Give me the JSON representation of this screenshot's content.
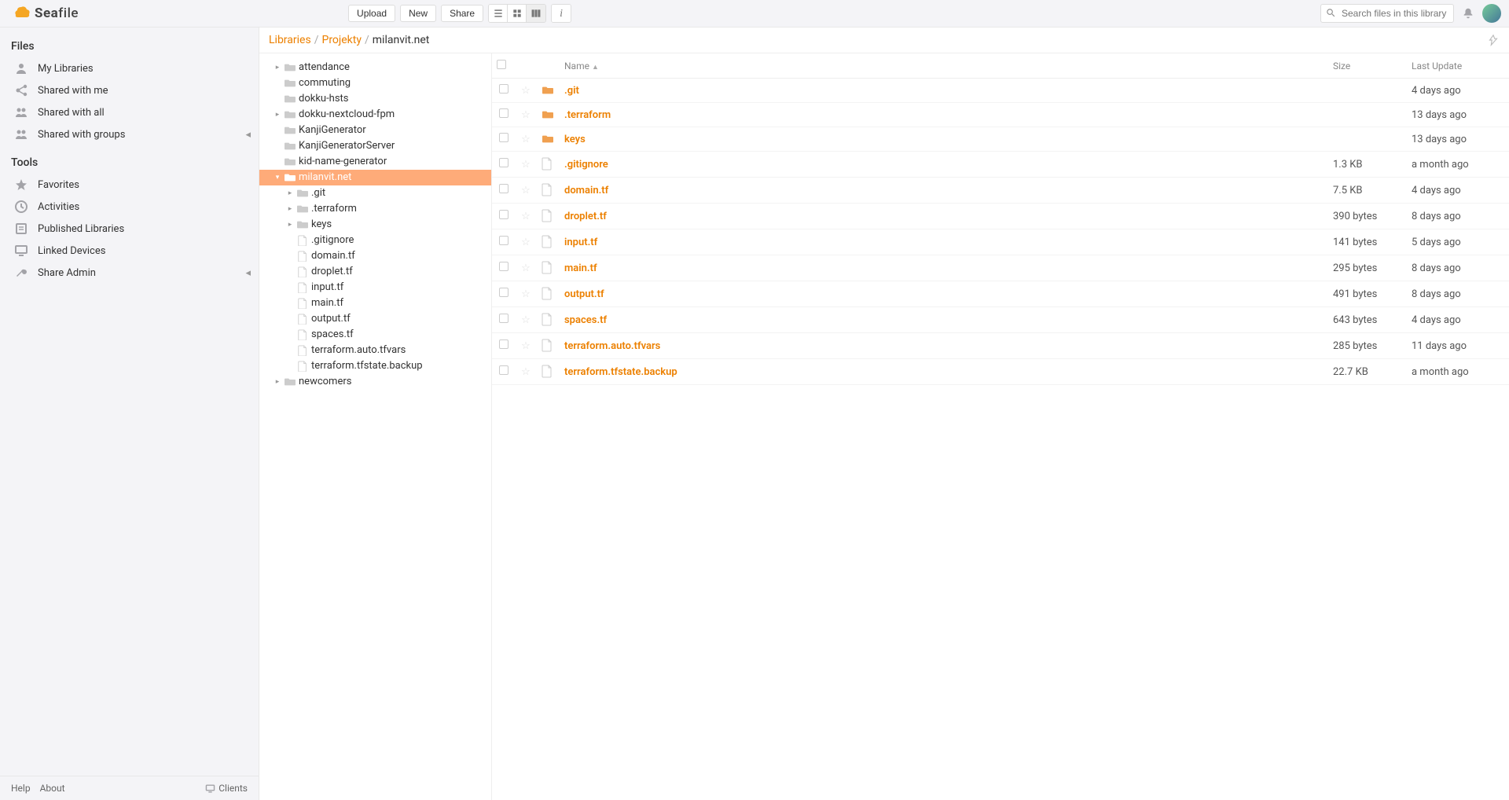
{
  "brand": {
    "bold": "Sea",
    "rest": "file"
  },
  "topbar": {
    "upload": "Upload",
    "new": "New",
    "share": "Share",
    "search_placeholder": "Search files in this library"
  },
  "sidebar": {
    "sections": {
      "files": {
        "title": "Files",
        "items": [
          {
            "label": "My Libraries",
            "icon": "user"
          },
          {
            "label": "Shared with me",
            "icon": "share-in"
          },
          {
            "label": "Shared with all",
            "icon": "share-all"
          },
          {
            "label": "Shared with groups",
            "icon": "group",
            "caret": true
          }
        ]
      },
      "tools": {
        "title": "Tools",
        "items": [
          {
            "label": "Favorites",
            "icon": "star"
          },
          {
            "label": "Activities",
            "icon": "clock"
          },
          {
            "label": "Published Libraries",
            "icon": "book"
          },
          {
            "label": "Linked Devices",
            "icon": "monitor"
          },
          {
            "label": "Share Admin",
            "icon": "wrench",
            "caret": true
          }
        ]
      }
    },
    "footer": {
      "help": "Help",
      "about": "About",
      "clients": "Clients"
    }
  },
  "breadcrumb": {
    "parts": [
      {
        "label": "Libraries",
        "link": true
      },
      {
        "label": "Projekty",
        "link": true
      },
      {
        "label": "milanvit.net",
        "link": false
      }
    ]
  },
  "tree": [
    {
      "name": "attendance",
      "type": "folder",
      "depth": 0,
      "expander": "▸"
    },
    {
      "name": "commuting",
      "type": "folder",
      "depth": 0,
      "expander": ""
    },
    {
      "name": "dokku-hsts",
      "type": "folder",
      "depth": 0,
      "expander": ""
    },
    {
      "name": "dokku-nextcloud-fpm",
      "type": "folder",
      "depth": 0,
      "expander": "▸"
    },
    {
      "name": "KanjiGenerator",
      "type": "folder",
      "depth": 0,
      "expander": ""
    },
    {
      "name": "KanjiGeneratorServer",
      "type": "folder",
      "depth": 0,
      "expander": ""
    },
    {
      "name": "kid-name-generator",
      "type": "folder",
      "depth": 0,
      "expander": ""
    },
    {
      "name": "milanvit.net",
      "type": "folder",
      "depth": 0,
      "expander": "▾",
      "selected": true
    },
    {
      "name": ".git",
      "type": "folder",
      "depth": 1,
      "expander": "▸"
    },
    {
      "name": ".terraform",
      "type": "folder",
      "depth": 1,
      "expander": "▸"
    },
    {
      "name": "keys",
      "type": "folder",
      "depth": 1,
      "expander": "▸"
    },
    {
      "name": ".gitignore",
      "type": "file",
      "depth": 1,
      "expander": ""
    },
    {
      "name": "domain.tf",
      "type": "file",
      "depth": 1,
      "expander": ""
    },
    {
      "name": "droplet.tf",
      "type": "file",
      "depth": 1,
      "expander": ""
    },
    {
      "name": "input.tf",
      "type": "file",
      "depth": 1,
      "expander": ""
    },
    {
      "name": "main.tf",
      "type": "file",
      "depth": 1,
      "expander": ""
    },
    {
      "name": "output.tf",
      "type": "file",
      "depth": 1,
      "expander": ""
    },
    {
      "name": "spaces.tf",
      "type": "file",
      "depth": 1,
      "expander": ""
    },
    {
      "name": "terraform.auto.tfvars",
      "type": "file",
      "depth": 1,
      "expander": ""
    },
    {
      "name": "terraform.tfstate.backup",
      "type": "file",
      "depth": 1,
      "expander": ""
    },
    {
      "name": "newcomers",
      "type": "folder",
      "depth": 0,
      "expander": "▸"
    }
  ],
  "table": {
    "headers": {
      "name": "Name",
      "size": "Size",
      "last_update": "Last Update"
    },
    "rows": [
      {
        "name": ".git",
        "type": "folder",
        "size": "",
        "updated": "4 days ago"
      },
      {
        "name": ".terraform",
        "type": "folder",
        "size": "",
        "updated": "13 days ago"
      },
      {
        "name": "keys",
        "type": "folder",
        "size": "",
        "updated": "13 days ago"
      },
      {
        "name": ".gitignore",
        "type": "file",
        "size": "1.3 KB",
        "updated": "a month ago"
      },
      {
        "name": "domain.tf",
        "type": "file",
        "size": "7.5 KB",
        "updated": "4 days ago"
      },
      {
        "name": "droplet.tf",
        "type": "file",
        "size": "390 bytes",
        "updated": "8 days ago"
      },
      {
        "name": "input.tf",
        "type": "file",
        "size": "141 bytes",
        "updated": "5 days ago"
      },
      {
        "name": "main.tf",
        "type": "file",
        "size": "295 bytes",
        "updated": "8 days ago"
      },
      {
        "name": "output.tf",
        "type": "file",
        "size": "491 bytes",
        "updated": "8 days ago"
      },
      {
        "name": "spaces.tf",
        "type": "file",
        "size": "643 bytes",
        "updated": "4 days ago"
      },
      {
        "name": "terraform.auto.tfvars",
        "type": "file",
        "size": "285 bytes",
        "updated": "11 days ago"
      },
      {
        "name": "terraform.tfstate.backup",
        "type": "file",
        "size": "22.7 KB",
        "updated": "a month ago"
      }
    ]
  }
}
